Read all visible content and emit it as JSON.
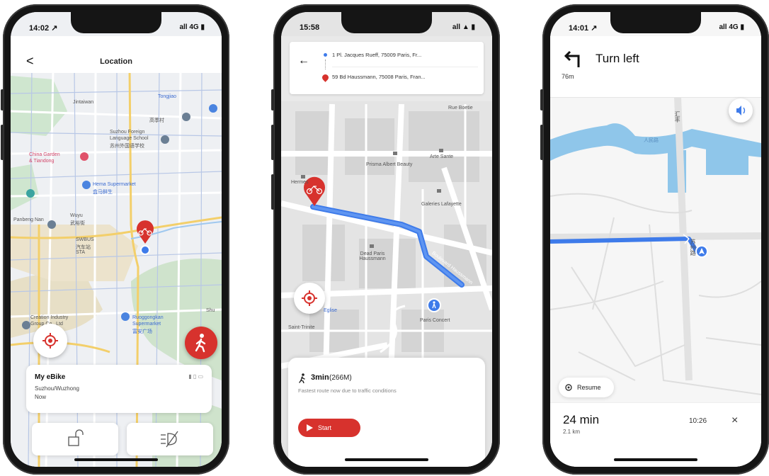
{
  "phone1": {
    "status": {
      "time": "14:02 ↗",
      "signal": "all 4G ▮"
    },
    "header": {
      "title": "Location",
      "back": "<"
    },
    "map_labels": [
      "Jintaiwan",
      "Tongjiao",
      "高季村",
      "Suzhou Foreign",
      "Language School",
      "苏州外国语学校",
      "China Garden",
      "& Tiandong",
      "Hema Supermarket",
      "盒马鲜生",
      "Panbeng Nan",
      "Wuyu",
      "武裕街",
      "SWBUS",
      "汽车站",
      "STA",
      "Creation Industry",
      "Group Co., Ltd",
      "Ruoggongkan",
      "Supermarket",
      "富安广场",
      "Shu"
    ],
    "card": {
      "title": "My eBike",
      "location": "Suzhou/Wuzhong",
      "time": "Now",
      "battery_icons": "▮ ▯ ▭"
    },
    "buttons": {
      "unlock": "unlock",
      "lights": "lights"
    }
  },
  "phone2": {
    "status": {
      "time": "15:58",
      "signal": "all ▲ ▮"
    },
    "from_address": "1 Pl. Jacques Rueff, 75009 Paris, Fr...",
    "to_address": "59 Bd Haussmann, 75008 Paris, Fran...",
    "map_labels": [
      "Rue Boetie",
      "Arte Sante",
      "Prisma Albert Beauty",
      "Galeries Lafayette",
      "Hermes",
      "Dead Paris Haussmann",
      "Paris Concert",
      "Eglise",
      "Saint-Trinite",
      "Boulevard Haussmann"
    ],
    "route": {
      "duration": "3min",
      "distance": "(266M)",
      "note": "Fastest route now due to traffic conditions"
    },
    "start_label": "Start"
  },
  "phone3": {
    "status": {
      "time": "14:01 ↗",
      "signal": "all 4G ▮"
    },
    "instruction": "Turn left",
    "distance": "76m",
    "map_labels": [
      "汇丰",
      "苏州路",
      "人民路"
    ],
    "resume_label": "Resume",
    "eta": {
      "duration": "24 min",
      "distance": "2.1 km",
      "arrival": "10:26"
    },
    "close": "×"
  },
  "colors": {
    "accent_red": "#d7322d",
    "route_blue": "#3e7bea",
    "water": "#8fc6ea"
  }
}
